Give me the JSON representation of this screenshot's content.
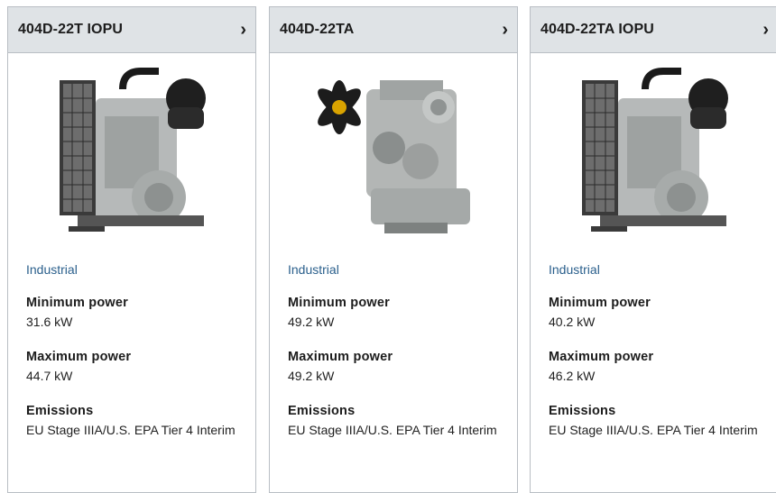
{
  "products": [
    {
      "title": "404D-22T IOPU",
      "image": "engine-with-radiator",
      "category": "Industrial",
      "min_power_label": "Minimum power",
      "min_power": "31.6 kW",
      "max_power_label": "Maximum power",
      "max_power": "44.7 kW",
      "emissions_label": "Emissions",
      "emissions": "EU Stage IIIA/U.S. EPA Tier 4 Interim"
    },
    {
      "title": "404D-22TA",
      "image": "bare-engine-with-fan",
      "category": "Industrial",
      "min_power_label": "Minimum power",
      "min_power": "49.2 kW",
      "max_power_label": "Maximum power",
      "max_power": "49.2 kW",
      "emissions_label": "Emissions",
      "emissions": "EU Stage IIIA/U.S. EPA Tier 4 Interim"
    },
    {
      "title": "404D-22TA IOPU",
      "image": "engine-with-radiator",
      "category": "Industrial",
      "min_power_label": "Minimum power",
      "min_power": "40.2 kW",
      "max_power_label": "Maximum power",
      "max_power": "46.2 kW",
      "emissions_label": "Emissions",
      "emissions": "EU Stage IIIA/U.S. EPA Tier 4 Interim"
    }
  ],
  "icons": {
    "expand": "chevron-right-icon",
    "chevron_glyph": "›"
  },
  "colors": {
    "header_bg": "#dfe3e6",
    "border": "#b9bec4",
    "category_link": "#2a5f8c"
  }
}
